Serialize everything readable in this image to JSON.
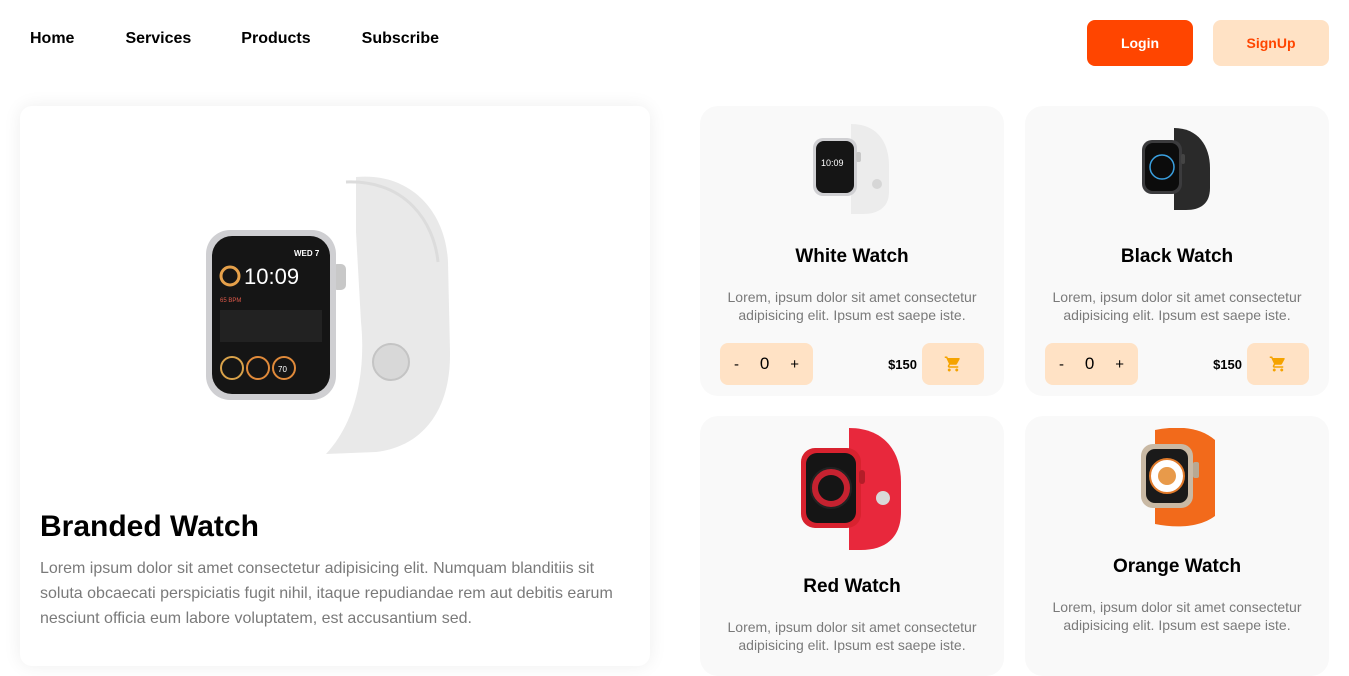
{
  "nav": {
    "links": [
      "Home",
      "Services",
      "Products",
      "Subscribe"
    ],
    "login_label": "Login",
    "signup_label": "SignUp"
  },
  "hero": {
    "title": "Branded Watch",
    "description": "Lorem ipsum dolor sit amet consectetur adipisicing elit. Numquam blanditiis sit soluta obcaecati perspiciatis fugit nihil, itaque repudiandae rem aut debitis earum nesciunt officia eum labore voluptatem, est accusantium sed."
  },
  "products": [
    {
      "title": "White Watch",
      "description": "Lorem, ipsum dolor sit amet consectetur adipisicing elit. Ipsum est saepe iste.",
      "qty": "0",
      "price": "$150",
      "minus": "-",
      "plus": "+"
    },
    {
      "title": "Black Watch",
      "description": "Lorem, ipsum dolor sit amet consectetur adipisicing elit. Ipsum est saepe iste.",
      "qty": "0",
      "price": "$150",
      "minus": "-",
      "plus": "+"
    },
    {
      "title": "Red Watch",
      "description": "Lorem, ipsum dolor sit amet consectetur adipisicing elit. Ipsum est saepe iste."
    },
    {
      "title": "Orange Watch",
      "description": "Lorem, ipsum dolor sit amet consectetur adipisicing elit. Ipsum est saepe iste."
    }
  ],
  "colors": {
    "accent": "#ff4500",
    "accent_light": "#ffe2c5",
    "card_bg": "#f9f9f9",
    "muted_text": "#7a7a7a"
  },
  "icons": [
    "cart-icon"
  ]
}
